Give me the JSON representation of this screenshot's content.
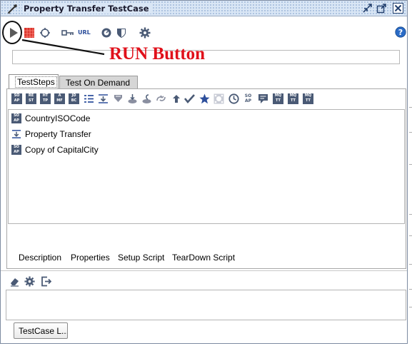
{
  "window": {
    "title": "Property Transfer TestCase",
    "title_icon": "wrench-icon",
    "controls": [
      "shrink-icon",
      "maximize-icon",
      "close-icon"
    ]
  },
  "toolbar": {
    "tools": [
      {
        "name": "run-icon",
        "tooltip": "Run"
      },
      {
        "name": "stop-grid-icon"
      },
      {
        "name": "loop-icon"
      },
      {
        "name": "key-icon"
      },
      {
        "name": "url-icon",
        "label": "URL"
      },
      {
        "name": "target-icon"
      },
      {
        "name": "shield-icon"
      },
      {
        "name": "gear-icon"
      },
      {
        "name": "help-icon"
      }
    ]
  },
  "annotation": {
    "label": "RUN Button",
    "color": "#e0101a"
  },
  "filter": {
    "value": "",
    "placeholder": ""
  },
  "tabs": [
    {
      "label": "TestSteps",
      "active": true
    },
    {
      "label": "Test On Demand",
      "active": false
    }
  ],
  "step_toolbar_icons": [
    "soap-icon",
    "rest-icon",
    "http-icon",
    "amf-icon",
    "jdbc-icon",
    "properties-icon",
    "property-transfer-icon",
    "conditional-goto-icon",
    "datasource-icon",
    "datasink-icon",
    "loop-icon",
    "assertion-icon",
    "check-icon",
    "star-icon",
    "mock-response-icon",
    "delay-icon",
    "soap-mock-icon",
    "manual-icon",
    "mqtt-publish-icon",
    "mqtt-drop-icon",
    "mqtt-receive-icon"
  ],
  "steps": [
    {
      "label": "CountryISOCode",
      "icon": "soap-request-icon"
    },
    {
      "label": "Property Transfer",
      "icon": "property-transfer-icon"
    },
    {
      "label": "Copy of CapitalCity",
      "icon": "soap-request-icon"
    }
  ],
  "bottom_tabs": [
    {
      "label": "Description"
    },
    {
      "label": "Properties"
    },
    {
      "label": "Setup Script"
    },
    {
      "label": "TearDown Script"
    }
  ],
  "log_toolbar": [
    "eraser-icon",
    "gear-icon",
    "export-icon"
  ],
  "log_button": {
    "label": "TestCase L..."
  }
}
